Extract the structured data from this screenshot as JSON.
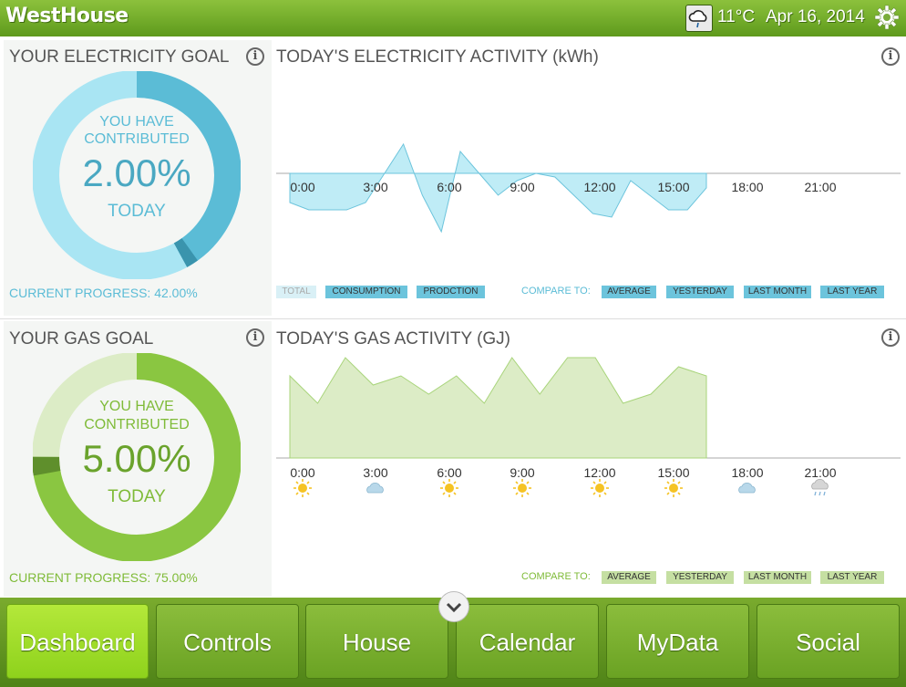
{
  "app": {
    "title": "WestHouse"
  },
  "header": {
    "temperature": "11°C",
    "date": "Apr 16, 2014",
    "weather_icon": "cloud-rain-icon",
    "settings_icon": "gear-icon"
  },
  "colors": {
    "brand_green": "#6fa82a",
    "electric_blue": "#5bbcd6",
    "electric_light": "#a9e5f3",
    "gas_green": "#8ac641",
    "gas_light": "#dcecc6"
  },
  "electricity": {
    "goal_title": "YOUR ELECTRICITY GOAL",
    "line1": "YOU HAVE",
    "line2": "CONTRIBUTED",
    "percent": "2.00%",
    "today": "TODAY",
    "progress": "CURRENT PROGRESS: 42.00%",
    "progress_fraction": 0.42,
    "activity_title": "TODAY'S ELECTRICITY ACTIVITY (kWh)",
    "legend": [
      "TOTAL",
      "CONSUMPTION",
      "PRODCTION"
    ],
    "compare_label": "COMPARE TO:",
    "compare": [
      "AVERAGE",
      "YESTERDAY",
      "LAST MONTH",
      "LAST YEAR"
    ]
  },
  "gas": {
    "goal_title": "YOUR GAS GOAL",
    "line1": "YOU HAVE",
    "line2": "CONTRIBUTED",
    "percent": "5.00%",
    "today": "TODAY",
    "progress": "CURRENT PROGRESS: 75.00%",
    "progress_fraction": 0.75,
    "activity_title": "TODAY'S GAS ACTIVITY (GJ)",
    "compare_label": "COMPARE TO:",
    "compare": [
      "AVERAGE",
      "YESTERDAY",
      "LAST MONTH",
      "LAST YEAR"
    ],
    "forecast": [
      "sun-icon",
      "cloud-icon",
      "sun-icon",
      "sun-icon",
      "sun-icon",
      "sun-icon",
      "cloud-icon",
      "rain-icon"
    ]
  },
  "hours": [
    "0:00",
    "3:00",
    "6:00",
    "9:00",
    "12:00",
    "15:00",
    "18:00",
    "21:00"
  ],
  "chart_data": [
    {
      "type": "area",
      "title": "TODAY'S ELECTRICITY ACTIVITY (kWh)",
      "x": [
        0,
        1,
        2,
        3,
        4,
        5,
        6,
        7,
        8,
        9,
        10,
        11,
        12,
        13,
        14,
        15,
        16,
        17
      ],
      "values": [
        -1.6,
        -2.0,
        -2.0,
        -2.0,
        -1.6,
        0.0,
        1.6,
        -1.2,
        -3.2,
        1.2,
        0.0,
        -1.2,
        -0.4,
        0.0,
        -0.2,
        -1.2,
        -2.2,
        -2.4,
        -0.4,
        -1.2,
        -2.0,
        -2.0,
        -0.8
      ],
      "note": ""
    },
    {
      "type": "area",
      "title": "TODAY'S GAS ACTIVITY (GJ)",
      "values": [
        0.9,
        0.6,
        1.1,
        0.8,
        0.9,
        0.7,
        0.9,
        0.6,
        1.1,
        0.7,
        1.1,
        1.1,
        0.6,
        0.7,
        1.0,
        0.9
      ]
    }
  ],
  "nav": {
    "items": [
      "Dashboard",
      "Controls",
      "House",
      "Calendar",
      "MyData",
      "Social"
    ],
    "active": "Dashboard"
  }
}
